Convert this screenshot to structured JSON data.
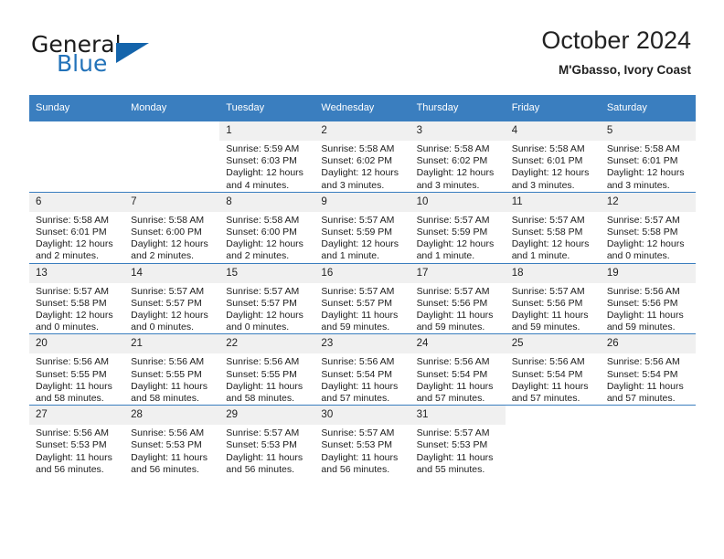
{
  "brand": {
    "name_top": "General",
    "name_bottom": "Blue",
    "accent_color": "#1464ab",
    "blue_text_color": "#2272b9"
  },
  "header": {
    "title": "October 2024",
    "subtitle": "M'Gbasso, Ivory Coast"
  },
  "theme": {
    "header_band": "#3a7ebf",
    "daynum_band": "#f0f0f0",
    "grid_line": "#3a7ebf"
  },
  "weekdays": [
    "Sunday",
    "Monday",
    "Tuesday",
    "Wednesday",
    "Thursday",
    "Friday",
    "Saturday"
  ],
  "weeks": [
    [
      {
        "day": "",
        "blank": true
      },
      {
        "day": "",
        "blank": true
      },
      {
        "day": "1",
        "sunrise": "Sunrise: 5:59 AM",
        "sunset": "Sunset: 6:03 PM",
        "daylight1": "Daylight: 12 hours",
        "daylight2": "and 4 minutes."
      },
      {
        "day": "2",
        "sunrise": "Sunrise: 5:58 AM",
        "sunset": "Sunset: 6:02 PM",
        "daylight1": "Daylight: 12 hours",
        "daylight2": "and 3 minutes."
      },
      {
        "day": "3",
        "sunrise": "Sunrise: 5:58 AM",
        "sunset": "Sunset: 6:02 PM",
        "daylight1": "Daylight: 12 hours",
        "daylight2": "and 3 minutes."
      },
      {
        "day": "4",
        "sunrise": "Sunrise: 5:58 AM",
        "sunset": "Sunset: 6:01 PM",
        "daylight1": "Daylight: 12 hours",
        "daylight2": "and 3 minutes."
      },
      {
        "day": "5",
        "sunrise": "Sunrise: 5:58 AM",
        "sunset": "Sunset: 6:01 PM",
        "daylight1": "Daylight: 12 hours",
        "daylight2": "and 3 minutes."
      }
    ],
    [
      {
        "day": "6",
        "sunrise": "Sunrise: 5:58 AM",
        "sunset": "Sunset: 6:01 PM",
        "daylight1": "Daylight: 12 hours",
        "daylight2": "and 2 minutes."
      },
      {
        "day": "7",
        "sunrise": "Sunrise: 5:58 AM",
        "sunset": "Sunset: 6:00 PM",
        "daylight1": "Daylight: 12 hours",
        "daylight2": "and 2 minutes."
      },
      {
        "day": "8",
        "sunrise": "Sunrise: 5:58 AM",
        "sunset": "Sunset: 6:00 PM",
        "daylight1": "Daylight: 12 hours",
        "daylight2": "and 2 minutes."
      },
      {
        "day": "9",
        "sunrise": "Sunrise: 5:57 AM",
        "sunset": "Sunset: 5:59 PM",
        "daylight1": "Daylight: 12 hours",
        "daylight2": "and 1 minute."
      },
      {
        "day": "10",
        "sunrise": "Sunrise: 5:57 AM",
        "sunset": "Sunset: 5:59 PM",
        "daylight1": "Daylight: 12 hours",
        "daylight2": "and 1 minute."
      },
      {
        "day": "11",
        "sunrise": "Sunrise: 5:57 AM",
        "sunset": "Sunset: 5:58 PM",
        "daylight1": "Daylight: 12 hours",
        "daylight2": "and 1 minute."
      },
      {
        "day": "12",
        "sunrise": "Sunrise: 5:57 AM",
        "sunset": "Sunset: 5:58 PM",
        "daylight1": "Daylight: 12 hours",
        "daylight2": "and 0 minutes."
      }
    ],
    [
      {
        "day": "13",
        "sunrise": "Sunrise: 5:57 AM",
        "sunset": "Sunset: 5:58 PM",
        "daylight1": "Daylight: 12 hours",
        "daylight2": "and 0 minutes."
      },
      {
        "day": "14",
        "sunrise": "Sunrise: 5:57 AM",
        "sunset": "Sunset: 5:57 PM",
        "daylight1": "Daylight: 12 hours",
        "daylight2": "and 0 minutes."
      },
      {
        "day": "15",
        "sunrise": "Sunrise: 5:57 AM",
        "sunset": "Sunset: 5:57 PM",
        "daylight1": "Daylight: 12 hours",
        "daylight2": "and 0 minutes."
      },
      {
        "day": "16",
        "sunrise": "Sunrise: 5:57 AM",
        "sunset": "Sunset: 5:57 PM",
        "daylight1": "Daylight: 11 hours",
        "daylight2": "and 59 minutes."
      },
      {
        "day": "17",
        "sunrise": "Sunrise: 5:57 AM",
        "sunset": "Sunset: 5:56 PM",
        "daylight1": "Daylight: 11 hours",
        "daylight2": "and 59 minutes."
      },
      {
        "day": "18",
        "sunrise": "Sunrise: 5:57 AM",
        "sunset": "Sunset: 5:56 PM",
        "daylight1": "Daylight: 11 hours",
        "daylight2": "and 59 minutes."
      },
      {
        "day": "19",
        "sunrise": "Sunrise: 5:56 AM",
        "sunset": "Sunset: 5:56 PM",
        "daylight1": "Daylight: 11 hours",
        "daylight2": "and 59 minutes."
      }
    ],
    [
      {
        "day": "20",
        "sunrise": "Sunrise: 5:56 AM",
        "sunset": "Sunset: 5:55 PM",
        "daylight1": "Daylight: 11 hours",
        "daylight2": "and 58 minutes."
      },
      {
        "day": "21",
        "sunrise": "Sunrise: 5:56 AM",
        "sunset": "Sunset: 5:55 PM",
        "daylight1": "Daylight: 11 hours",
        "daylight2": "and 58 minutes."
      },
      {
        "day": "22",
        "sunrise": "Sunrise: 5:56 AM",
        "sunset": "Sunset: 5:55 PM",
        "daylight1": "Daylight: 11 hours",
        "daylight2": "and 58 minutes."
      },
      {
        "day": "23",
        "sunrise": "Sunrise: 5:56 AM",
        "sunset": "Sunset: 5:54 PM",
        "daylight1": "Daylight: 11 hours",
        "daylight2": "and 57 minutes."
      },
      {
        "day": "24",
        "sunrise": "Sunrise: 5:56 AM",
        "sunset": "Sunset: 5:54 PM",
        "daylight1": "Daylight: 11 hours",
        "daylight2": "and 57 minutes."
      },
      {
        "day": "25",
        "sunrise": "Sunrise: 5:56 AM",
        "sunset": "Sunset: 5:54 PM",
        "daylight1": "Daylight: 11 hours",
        "daylight2": "and 57 minutes."
      },
      {
        "day": "26",
        "sunrise": "Sunrise: 5:56 AM",
        "sunset": "Sunset: 5:54 PM",
        "daylight1": "Daylight: 11 hours",
        "daylight2": "and 57 minutes."
      }
    ],
    [
      {
        "day": "27",
        "sunrise": "Sunrise: 5:56 AM",
        "sunset": "Sunset: 5:53 PM",
        "daylight1": "Daylight: 11 hours",
        "daylight2": "and 56 minutes."
      },
      {
        "day": "28",
        "sunrise": "Sunrise: 5:56 AM",
        "sunset": "Sunset: 5:53 PM",
        "daylight1": "Daylight: 11 hours",
        "daylight2": "and 56 minutes."
      },
      {
        "day": "29",
        "sunrise": "Sunrise: 5:57 AM",
        "sunset": "Sunset: 5:53 PM",
        "daylight1": "Daylight: 11 hours",
        "daylight2": "and 56 minutes."
      },
      {
        "day": "30",
        "sunrise": "Sunrise: 5:57 AM",
        "sunset": "Sunset: 5:53 PM",
        "daylight1": "Daylight: 11 hours",
        "daylight2": "and 56 minutes."
      },
      {
        "day": "31",
        "sunrise": "Sunrise: 5:57 AM",
        "sunset": "Sunset: 5:53 PM",
        "daylight1": "Daylight: 11 hours",
        "daylight2": "and 55 minutes."
      },
      {
        "day": "",
        "blank": true
      },
      {
        "day": "",
        "blank": true
      }
    ]
  ]
}
